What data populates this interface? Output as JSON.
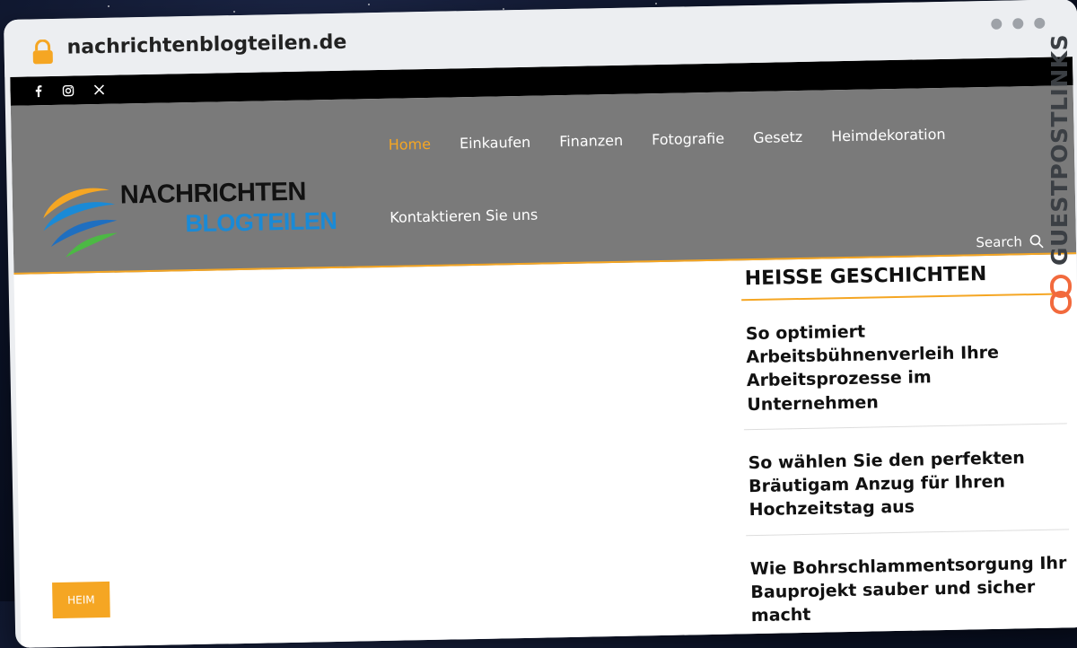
{
  "browser": {
    "url": "nachrichtenblogteilen.de"
  },
  "topbar": {
    "social": [
      "facebook-icon",
      "instagram-icon",
      "x-icon"
    ]
  },
  "logo": {
    "line1": "NACHRICHTEN",
    "line2": "BLOGTEILEN"
  },
  "nav": {
    "row1": [
      "Home",
      "Einkaufen",
      "Finanzen",
      "Fotografie",
      "Gesetz",
      "Heimdekoration"
    ],
    "row2": [
      "Kontaktieren Sie uns"
    ],
    "active": "Home"
  },
  "search": {
    "label": "Search"
  },
  "sidebar": {
    "title": "HEISSE GESCHICHTEN",
    "stories": [
      "So optimiert Arbeitsbühnenverleih Ihre Arbeitsprozesse im Unternehmen",
      "So wählen Sie den perfekten Bräutigam Anzug für Ihren Hochzeitstag aus",
      "Wie Bohrschlammentsorgung Ihr Bauprojekt sauber und sicher macht"
    ]
  },
  "breadcrumb": {
    "heim": "HEIM"
  },
  "watermark": {
    "text": "GUESTPOSTLINKS"
  },
  "colors": {
    "accent": "#f5a623",
    "header_bg": "#7a7a7a",
    "logo_blue": "#1a8ad6"
  }
}
